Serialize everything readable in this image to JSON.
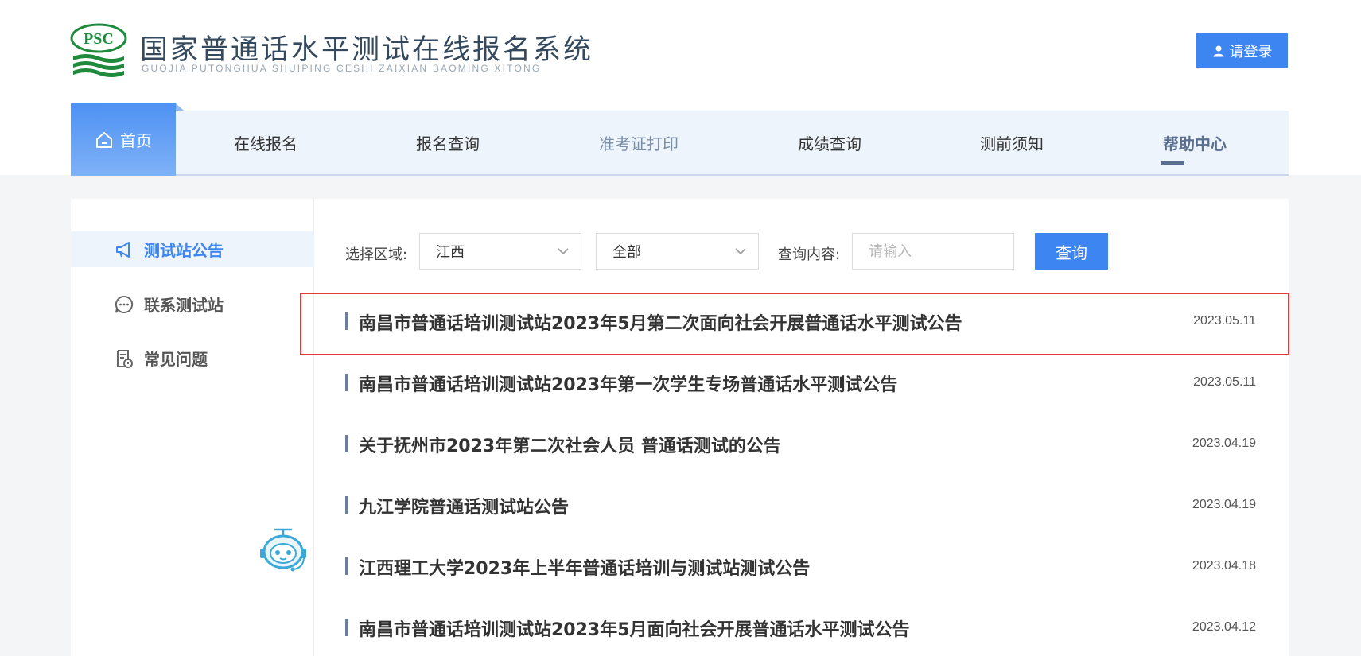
{
  "header": {
    "logo_text": "PSC",
    "title": "国家普通话水平测试在线报名系统",
    "subtitle": "GUOJIA PUTONGHUA SHUIPING CESHI ZAIXIAN BAOMING XITONG",
    "login_label": "请登录",
    "login_icon": "user-icon"
  },
  "nav": {
    "home_label": "首页",
    "home_icon": "home-icon",
    "items": [
      "在线报名",
      "报名查询",
      "准考证打印",
      "成绩查询",
      "测前须知",
      "帮助中心"
    ],
    "active": "帮助中心"
  },
  "sidebar": {
    "items": [
      {
        "label": "测试站公告",
        "icon": "megaphone-icon",
        "active": true
      },
      {
        "label": "联系测试站",
        "icon": "chat-icon",
        "active": false
      },
      {
        "label": "常见问题",
        "icon": "faq-document-icon",
        "active": false
      }
    ],
    "assistant_icon": "robot-assistant-icon"
  },
  "filters": {
    "region_label": "选择区域:",
    "region_value": "江西",
    "category_value": "全部",
    "query_label": "查询内容:",
    "query_placeholder": "请输入",
    "query_value": "",
    "search_label": "查询"
  },
  "announcements": [
    {
      "title": "南昌市普通话培训测试站2023年5月第二次面向社会开展普通话水平测试公告",
      "date": "2023.05.11",
      "highlighted": true
    },
    {
      "title": "南昌市普通话培训测试站2023年第一次学生专场普通话水平测试公告",
      "date": "2023.05.11"
    },
    {
      "title": "关于抚州市2023年第二次社会人员 普通话测试的公告",
      "date": "2023.04.19"
    },
    {
      "title": "九江学院普通话测试站公告",
      "date": "2023.04.19"
    },
    {
      "title": "江西理工大学2023年上半年普通话培训与测试站测试公告",
      "date": "2023.04.18"
    },
    {
      "title": "南昌市普通话培训测试站2023年5月面向社会开展普通话水平测试公告",
      "date": "2023.04.12"
    }
  ],
  "colors": {
    "accent": "#3d86f2",
    "highlight_border": "#e53935",
    "nav_bg": "#eef4fb"
  }
}
